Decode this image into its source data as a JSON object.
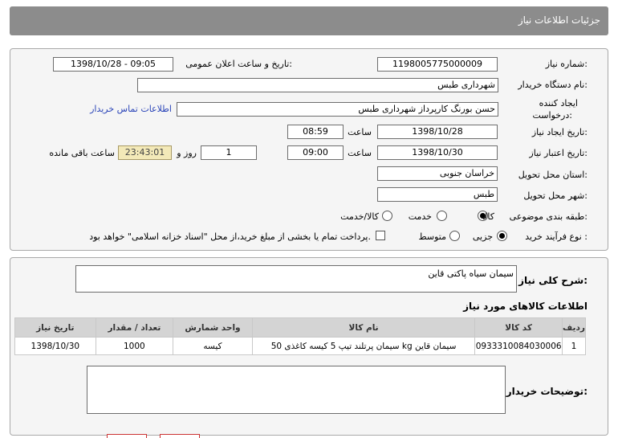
{
  "header": {
    "title": "جزئیات اطلاعات نیاز"
  },
  "fields": {
    "need_number_label": "شماره نیاز:",
    "need_number": "1198005775000009",
    "announce_label": "تاریخ و ساعت اعلان عمومی:",
    "announce_value": "1398/10/28 - 09:05",
    "buyer_org_label": "نام دستگاه خریدار:",
    "buyer_org": "شهرداری طبس",
    "requester_label_1": "ایجاد کننده",
    "requester_label_2": "درخواست:",
    "requester": "حسن بورنگ کارپرداز شهرداری طبس",
    "contact_link": "اطلاعات تماس خریدار",
    "created_label": "تاریخ ایجاد نیاز:",
    "created_date": "1398/10/28",
    "time_label": "ساعت",
    "created_time": "08:59",
    "validity_label": "تاریخ اعتبار نیاز:",
    "validity_date": "1398/10/30",
    "validity_time": "09:00",
    "days_value": "1",
    "days_label": "روز و",
    "remaining_time": "23:43:01",
    "remaining_label": "ساعت باقی مانده",
    "province_label": "استان محل تحویل:",
    "province": "خراسان جنوبی",
    "city_label": "شهر محل تحویل:",
    "city": "طبس",
    "category_label": "طبقه بندی موضوعی:",
    "category_options": [
      "کالا",
      "خدمت",
      "کالا/خدمت"
    ],
    "process_label": "نوع فرآیند خرید :",
    "process_options": [
      "جزیی",
      "متوسط"
    ],
    "payment_note": "پرداخت تمام یا بخشی از مبلغ خرید،از محل \"اسناد خزانه اسلامی\" خواهد بود."
  },
  "description": {
    "label": "شرح کلی نیاز:",
    "value": "سیمان سیاه پاکتی قاین"
  },
  "goods": {
    "title": "اطلاعات کالاهای مورد نیاز",
    "columns": [
      "ردیف",
      "کد کالا",
      "نام کالا",
      "واحد شمارش",
      "تعداد / مقدار",
      "تاریخ نیاز"
    ],
    "rows": [
      [
        "1",
        "0933310084030006",
        "سیمان پرتلند تیپ 5 کیسه کاغذی 50 kg سیمان قاین",
        "کیسه",
        "1000",
        "1398/10/30"
      ]
    ]
  },
  "buyer_notes": {
    "label": "توضیحات خریدار:"
  }
}
